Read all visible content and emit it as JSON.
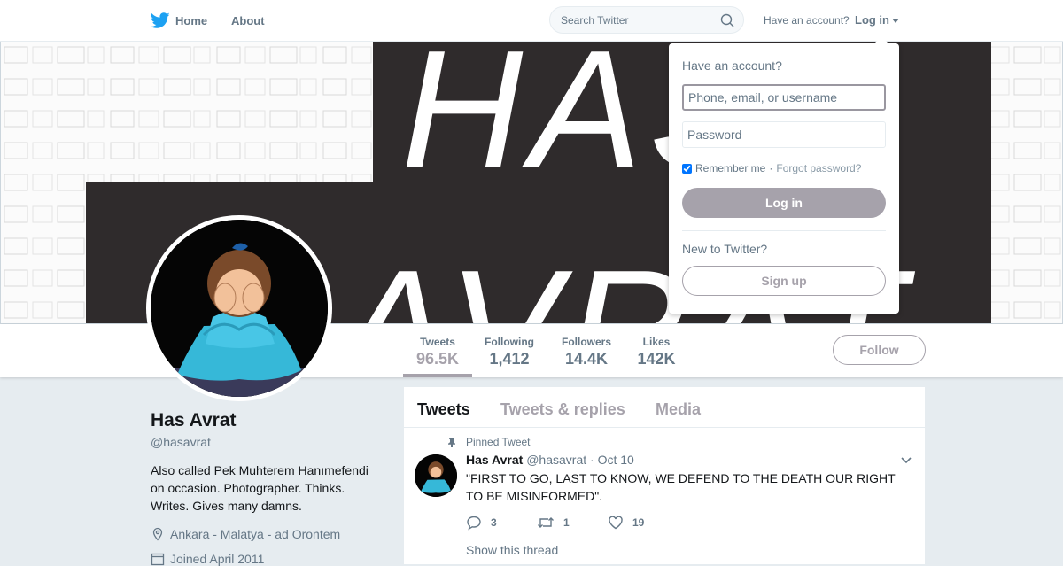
{
  "nav": {
    "home_label": "Home",
    "about_label": "About",
    "search_placeholder": "Search Twitter",
    "have_account": "Have an account?",
    "login_label": "Log in"
  },
  "banner": {
    "text_line1": "HAS",
    "text_line2": "AVRAT",
    "bg_color": "#2f2b2c"
  },
  "stats": [
    {
      "label": "Tweets",
      "value": "96.5K"
    },
    {
      "label": "Following",
      "value": "1,412"
    },
    {
      "label": "Followers",
      "value": "14.4K"
    },
    {
      "label": "Likes",
      "value": "142K"
    }
  ],
  "follow_label": "Follow",
  "profile": {
    "name": "Has Avrat",
    "handle": "@hasavrat",
    "bio": "Also called Pek Muhterem Hanımefendi on occasion. Photographer. Thinks. Writes. Gives many damns.",
    "location": "Ankara - Malatya - ad Orontem",
    "joined": "Joined April 2011"
  },
  "timeline": {
    "tabs": [
      "Tweets",
      "Tweets & replies",
      "Media"
    ]
  },
  "tweet": {
    "pinned_label": "Pinned Tweet",
    "name": "Has Avrat",
    "handle": "@hasavrat",
    "dot": "·",
    "date": "Oct 10",
    "text": "\"FIRST TO GO, LAST TO KNOW, WE DEFEND TO THE DEATH OUR RIGHT TO BE MISINFORMED\".",
    "replies": "3",
    "retweets": "1",
    "likes": "19",
    "show_thread": "Show this thread"
  },
  "login_dropdown": {
    "title": "Have an account?",
    "username_placeholder": "Phone, email, or username",
    "password_placeholder": "Password",
    "remember_label": "Remember me",
    "separator": "·",
    "forgot_label": "Forgot password?",
    "login_button": "Log in",
    "new_label": "New to Twitter?",
    "signup_button": "Sign up"
  },
  "colors": {
    "accent": "#a6a2ab",
    "twitter_blue": "#1da1f2",
    "page_bg": "#e6ecf0"
  }
}
